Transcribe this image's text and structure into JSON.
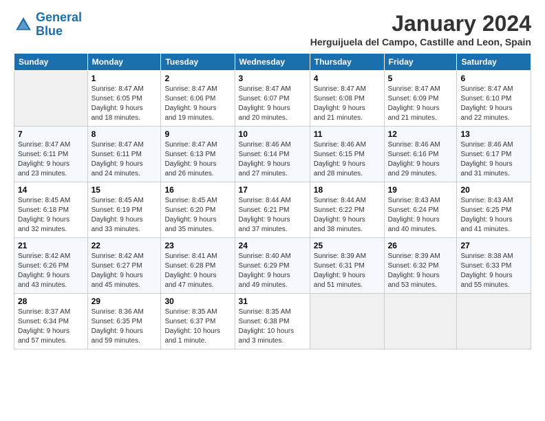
{
  "logo": {
    "line1": "General",
    "line2": "Blue"
  },
  "title": "January 2024",
  "subtitle": "Herguijuela del Campo, Castille and Leon, Spain",
  "columns": [
    "Sunday",
    "Monday",
    "Tuesday",
    "Wednesday",
    "Thursday",
    "Friday",
    "Saturday"
  ],
  "weeks": [
    [
      {
        "num": "",
        "info": ""
      },
      {
        "num": "1",
        "info": "Sunrise: 8:47 AM\nSunset: 6:05 PM\nDaylight: 9 hours\nand 18 minutes."
      },
      {
        "num": "2",
        "info": "Sunrise: 8:47 AM\nSunset: 6:06 PM\nDaylight: 9 hours\nand 19 minutes."
      },
      {
        "num": "3",
        "info": "Sunrise: 8:47 AM\nSunset: 6:07 PM\nDaylight: 9 hours\nand 20 minutes."
      },
      {
        "num": "4",
        "info": "Sunrise: 8:47 AM\nSunset: 6:08 PM\nDaylight: 9 hours\nand 21 minutes."
      },
      {
        "num": "5",
        "info": "Sunrise: 8:47 AM\nSunset: 6:09 PM\nDaylight: 9 hours\nand 21 minutes."
      },
      {
        "num": "6",
        "info": "Sunrise: 8:47 AM\nSunset: 6:10 PM\nDaylight: 9 hours\nand 22 minutes."
      }
    ],
    [
      {
        "num": "7",
        "info": ""
      },
      {
        "num": "8",
        "info": "Sunrise: 8:47 AM\nSunset: 6:11 PM\nDaylight: 9 hours\nand 24 minutes."
      },
      {
        "num": "9",
        "info": "Sunrise: 8:47 AM\nSunset: 6:13 PM\nDaylight: 9 hours\nand 26 minutes."
      },
      {
        "num": "10",
        "info": "Sunrise: 8:46 AM\nSunset: 6:14 PM\nDaylight: 9 hours\nand 27 minutes."
      },
      {
        "num": "11",
        "info": "Sunrise: 8:46 AM\nSunset: 6:15 PM\nDaylight: 9 hours\nand 28 minutes."
      },
      {
        "num": "12",
        "info": "Sunrise: 8:46 AM\nSunset: 6:16 PM\nDaylight: 9 hours\nand 29 minutes."
      },
      {
        "num": "13",
        "info": "Sunrise: 8:46 AM\nSunset: 6:17 PM\nDaylight: 9 hours\nand 31 minutes."
      }
    ],
    [
      {
        "num": "14",
        "info": ""
      },
      {
        "num": "15",
        "info": "Sunrise: 8:45 AM\nSunset: 6:19 PM\nDaylight: 9 hours\nand 33 minutes."
      },
      {
        "num": "16",
        "info": "Sunrise: 8:45 AM\nSunset: 6:20 PM\nDaylight: 9 hours\nand 35 minutes."
      },
      {
        "num": "17",
        "info": "Sunrise: 8:44 AM\nSunset: 6:21 PM\nDaylight: 9 hours\nand 37 minutes."
      },
      {
        "num": "18",
        "info": "Sunrise: 8:44 AM\nSunset: 6:22 PM\nDaylight: 9 hours\nand 38 minutes."
      },
      {
        "num": "19",
        "info": "Sunrise: 8:43 AM\nSunset: 6:24 PM\nDaylight: 9 hours\nand 40 minutes."
      },
      {
        "num": "20",
        "info": "Sunrise: 8:43 AM\nSunset: 6:25 PM\nDaylight: 9 hours\nand 41 minutes."
      }
    ],
    [
      {
        "num": "21",
        "info": ""
      },
      {
        "num": "22",
        "info": "Sunrise: 8:42 AM\nSunset: 6:27 PM\nDaylight: 9 hours\nand 45 minutes."
      },
      {
        "num": "23",
        "info": "Sunrise: 8:41 AM\nSunset: 6:28 PM\nDaylight: 9 hours\nand 47 minutes."
      },
      {
        "num": "24",
        "info": "Sunrise: 8:40 AM\nSunset: 6:29 PM\nDaylight: 9 hours\nand 49 minutes."
      },
      {
        "num": "25",
        "info": "Sunrise: 8:39 AM\nSunset: 6:31 PM\nDaylight: 9 hours\nand 51 minutes."
      },
      {
        "num": "26",
        "info": "Sunrise: 8:39 AM\nSunset: 6:32 PM\nDaylight: 9 hours\nand 53 minutes."
      },
      {
        "num": "27",
        "info": "Sunrise: 8:38 AM\nSunset: 6:33 PM\nDaylight: 9 hours\nand 55 minutes."
      }
    ],
    [
      {
        "num": "28",
        "info": "Sunrise: 8:37 AM\nSunset: 6:34 PM\nDaylight: 9 hours\nand 57 minutes."
      },
      {
        "num": "29",
        "info": "Sunrise: 8:36 AM\nSunset: 6:35 PM\nDaylight: 9 hours\nand 59 minutes."
      },
      {
        "num": "30",
        "info": "Sunrise: 8:35 AM\nSunset: 6:37 PM\nDaylight: 10 hours\nand 1 minute."
      },
      {
        "num": "31",
        "info": "Sunrise: 8:35 AM\nSunset: 6:38 PM\nDaylight: 10 hours\nand 3 minutes."
      },
      {
        "num": "",
        "info": ""
      },
      {
        "num": "",
        "info": ""
      },
      {
        "num": "",
        "info": ""
      }
    ]
  ],
  "week14_sun": "Sunrise: 8:45 AM\nSunset: 6:18 PM\nDaylight: 9 hours\nand 32 minutes.",
  "week21_sun": "Sunrise: 8:42 AM\nSunset: 6:26 PM\nDaylight: 9 hours\nand 43 minutes."
}
